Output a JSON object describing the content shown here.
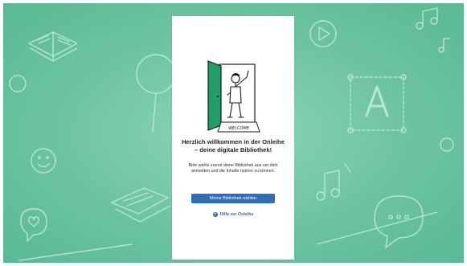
{
  "welcome": {
    "headline": "Herzlich willkommen in der Onleihe – deine digitale Bibliothek!",
    "subtext": "Bitte wähle zuerst deine Bibliothek aus um dich anmelden und die Inhalte nutzen zu können.",
    "illustration_sign": "WELCOME",
    "choose_library_label": "Meine Bibliothek wählen",
    "help_label": "Hilfe zur Onleihe",
    "help_icon_glyph": "?"
  },
  "colors": {
    "background": "#6cc3a2",
    "door": "#1f9e6a",
    "primary": "#2f6db5",
    "card": "#ffffff"
  },
  "icons": [
    "open-book-icon",
    "music-note-icon",
    "play-button-icon",
    "font-letter-icon",
    "magnifier-icon",
    "smiley-icon",
    "chat-bubble-icon",
    "heart-bubble-icon"
  ]
}
